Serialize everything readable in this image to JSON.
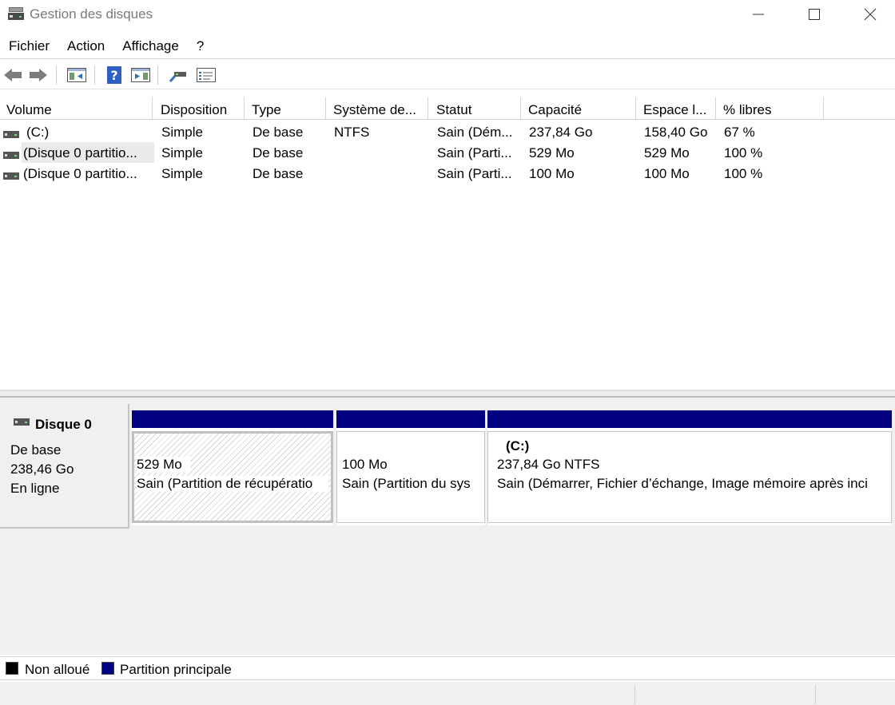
{
  "window": {
    "title": "Gestion des disques"
  },
  "menu": [
    "Fichier",
    "Action",
    "Affichage",
    "?"
  ],
  "toolbar": {
    "buttons": [
      "back-arrow-icon",
      "forward-arrow-icon",
      "console-tree-icon",
      "help-icon",
      "action-pane-icon",
      "connect-icon",
      "properties-icon"
    ]
  },
  "volumes": {
    "headers": [
      "Volume",
      "Disposition",
      "Type",
      "Système de...",
      "Statut",
      "Capacité",
      "Espace l...",
      "% libres"
    ],
    "rows": [
      [
        "(C:)",
        "Simple",
        "De base",
        "NTFS",
        "Sain (Dém...",
        "237,84 Go",
        "158,40 Go",
        "67 %"
      ],
      [
        "(Disque 0 partitio...",
        "Simple",
        "De base",
        "",
        "Sain (Parti...",
        "529 Mo",
        "529 Mo",
        "100 %"
      ],
      [
        "(Disque 0 partitio...",
        "Simple",
        "De base",
        "",
        "Sain (Parti...",
        "100 Mo",
        "100 Mo",
        "100 %"
      ]
    ],
    "selected_row": 1
  },
  "disk": {
    "name": "Disque 0",
    "type": "De base",
    "size": "238,46 Go",
    "status": "En ligne",
    "partitions": [
      {
        "title": "",
        "size": "529 Mo",
        "status": "Sain (Partition de récupératio",
        "selected": true
      },
      {
        "title": "",
        "size": "100 Mo",
        "status": "Sain (Partition du sys",
        "selected": false
      },
      {
        "title": "(C:)",
        "size": "237,84 Go NTFS",
        "status": "Sain (Démarrer, Fichier d’échange, Image mémoire après inci",
        "selected": false
      }
    ]
  },
  "legend": [
    {
      "label": "Non alloué",
      "color": "#000000"
    },
    {
      "label": "Partition principale",
      "color": "#000080"
    }
  ]
}
